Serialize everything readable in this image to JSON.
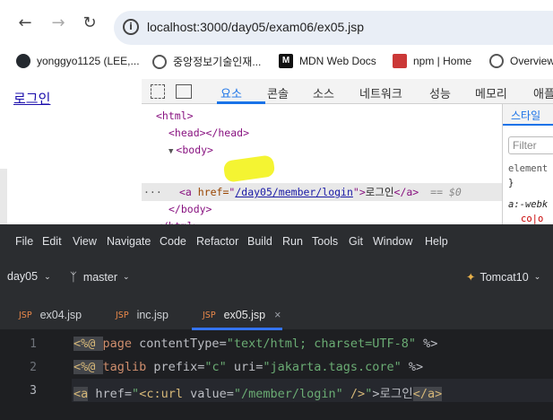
{
  "browser": {
    "url": "localhost:3000/day05/exam06/ex05.jsp",
    "bookmarks": [
      {
        "label": "yonggyo1125 (LEE,...",
        "icon": "github-icon"
      },
      {
        "label": "중앙정보기술인재...",
        "icon": "globe-icon"
      },
      {
        "label": "MDN Web Docs",
        "icon": "mdn-icon"
      },
      {
        "label": "npm | Home",
        "icon": "npm-icon"
      },
      {
        "label": "Overview",
        "icon": "globe-icon"
      }
    ]
  },
  "page": {
    "link_text": "로그인"
  },
  "devtools": {
    "tabs": [
      "요소",
      "콘솔",
      "소스",
      "네트워크",
      "성능",
      "메모리",
      "애플"
    ],
    "active_tab": "요소",
    "dom": {
      "l1": "<html>",
      "l2": "<head></head>",
      "l3": "<body>",
      "l4_open": "<a ",
      "l4_attr": "href=",
      "l4_q1": "\"",
      "l4_val": "/day05/member/login",
      "l4_q2": "\"",
      "l4_gt": ">",
      "l4_text": "로그인",
      "l4_close": "</a>",
      "l4_sel": "== $0",
      "l5": "</body>",
      "l6": "</html>",
      "dots": "···"
    },
    "styles": {
      "tab": "스타일",
      "filter_placeholder": "Filter",
      "element_text": "element",
      "brace": "}",
      "webkit_text": "a:-webk",
      "color_text": "co|o"
    }
  },
  "ide": {
    "menu": [
      "File",
      "Edit",
      "View",
      "Navigate",
      "Code",
      "Refactor",
      "Build",
      "Run",
      "Tools",
      "Git",
      "Window",
      "Help"
    ],
    "menu_mnemonic": [
      "F",
      "E",
      "V",
      "N",
      "C",
      "R",
      "B",
      "u",
      "T",
      "G",
      "W",
      "H"
    ],
    "project": "day05",
    "branch": "master",
    "run_config": "Tomcat10",
    "file_tabs": [
      {
        "badge": "JSP",
        "name": "ex04.jsp"
      },
      {
        "badge": "JSP",
        "name": "inc.jsp"
      },
      {
        "badge": "JSP",
        "name": "ex05.jsp"
      }
    ],
    "close_glyph": "×",
    "line_numbers": [
      "1",
      "2",
      "3"
    ],
    "code": {
      "l1_a": "<%@ ",
      "l1_b": "page",
      "l1_c": " contentType=",
      "l1_d": "\"text/html; charset=UTF-8\"",
      "l1_e": " %>",
      "l2_a": "<%@ ",
      "l2_b": "taglib",
      "l2_c": " prefix=",
      "l2_d": "\"c\"",
      "l2_e": " uri=",
      "l2_f": "\"jakarta.tags.core\"",
      "l2_g": " %>",
      "l3_a": "<a",
      "l3_b": " href=",
      "l3_c": "\"",
      "l3_d": "<c:url",
      "l3_e": " value=",
      "l3_f": "\"/member/login\"",
      "l3_g": " />",
      "l3_h": "\"",
      "l3_i": ">로그인",
      "l3_j": "</a>"
    }
  },
  "colors": {
    "ide_bg": "#2b2d30",
    "editor_bg": "#1e1f22",
    "accent": "#3574f0",
    "devtools_accent": "#1a73e8"
  }
}
